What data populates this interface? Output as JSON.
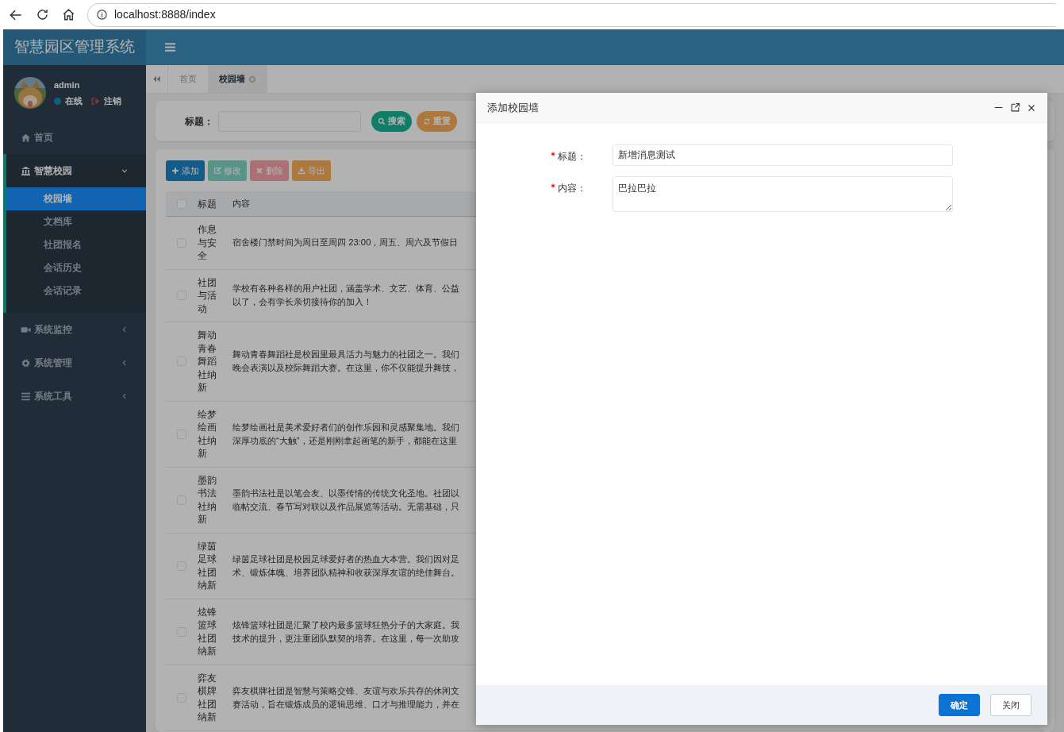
{
  "browser": {
    "url": "localhost:8888/index"
  },
  "app": {
    "title": "智慧园区管理系统"
  },
  "user": {
    "name": "admin",
    "status": "在线",
    "logout": "注销"
  },
  "sidebar": {
    "items": [
      {
        "kind": "link",
        "label": "首页"
      },
      {
        "kind": "group",
        "label": "智慧校园",
        "expanded": true,
        "children": [
          {
            "label": "校园墙",
            "selected": true
          },
          {
            "label": "文档库",
            "selected": false
          },
          {
            "label": "社团报名",
            "selected": false
          },
          {
            "label": "会话历史",
            "selected": false
          },
          {
            "label": "会话记录",
            "selected": false
          }
        ]
      },
      {
        "kind": "group",
        "label": "系统监控",
        "expanded": false
      },
      {
        "kind": "group",
        "label": "系统管理",
        "expanded": false
      },
      {
        "kind": "group",
        "label": "系统工具",
        "expanded": false
      }
    ]
  },
  "tabs": [
    {
      "label": "首页",
      "selected": false,
      "closable": false
    },
    {
      "label": "校园墙",
      "selected": true,
      "closable": true
    }
  ],
  "search": {
    "label": "标题：",
    "buttons": [
      {
        "label": "搜索",
        "kind": "search"
      },
      {
        "label": "重置",
        "kind": "reset"
      }
    ]
  },
  "toolbar": [
    {
      "label": "添加",
      "kind": "add",
      "disabled": false
    },
    {
      "label": "修改",
      "kind": "edit",
      "disabled": true
    },
    {
      "label": "删除",
      "kind": "delete",
      "disabled": true
    },
    {
      "label": "导出",
      "kind": "export",
      "disabled": false
    }
  ],
  "table": {
    "select_all": false,
    "columns": [
      "标题",
      "内容"
    ],
    "rows": [
      {
        "checked": false,
        "title": "作息与安全",
        "content": [
          "宿舍楼门禁时间为周日至周四 23:00，周五、周六及节假日"
        ]
      },
      {
        "checked": false,
        "title": "社团与活动",
        "content": [
          "学校有各种各样的用户社团，涵盖学术、文艺、体育、公益",
          "以了，会有学长亲切接待你的加入！"
        ]
      },
      {
        "checked": false,
        "title": "舞动青春舞蹈社纳新",
        "content": [
          "舞动青春舞蹈社是校园里最具活力与魅力的社团之一。我们",
          "晚会表演以及校际舞蹈大赛。在这里，你不仅能提升舞技，"
        ]
      },
      {
        "checked": false,
        "title": "绘梦绘画社纳新",
        "content": [
          "绘梦绘画社是美术爱好者们的创作乐园和灵感聚集地。我们",
          "深厚功底的“大触”，还是刚刚拿起画笔的新手，都能在这里"
        ]
      },
      {
        "checked": false,
        "title": "墨韵书法社纳新",
        "content": [
          "墨韵书法社是以笔会友、以墨传情的传统文化圣地。社团以",
          "临帖交流、春节写对联以及作品展览等活动。无需基础，只"
        ]
      },
      {
        "checked": false,
        "title": "绿茵足球社团纳新",
        "content": [
          "绿茵足球社团是校园足球爱好者的热血大本营。我们因对足",
          "术、锻炼体魄、培养团队精神和收获深厚友谊的绝佳舞台。"
        ]
      },
      {
        "checked": false,
        "title": "炫锋篮球社团纳新",
        "content": [
          "炫锋篮球社团是汇聚了校内最多篮球狂热分子的大家庭。我",
          "技术的提升，更注重团队默契的培养。在这里，每一次助攻"
        ]
      },
      {
        "checked": false,
        "title": "弈友棋牌社团纳新",
        "content": [
          "弈友棋牌社团是智慧与策略交锋、友谊与欢乐共存的休闲文",
          "赛活动，旨在锻炼成员的逻辑思维、口才与推理能力，并在"
        ]
      }
    ]
  },
  "dialog": {
    "title": "添加校园墙",
    "fields": [
      {
        "kind": "input",
        "label": "标题：",
        "required": true,
        "value": "新增消息测试"
      },
      {
        "kind": "textarea",
        "label": "内容：",
        "required": true,
        "value": "巴拉巴拉"
      }
    ],
    "buttons": [
      {
        "label": "确定",
        "primary": true
      },
      {
        "label": "关闭",
        "primary": false
      }
    ]
  }
}
